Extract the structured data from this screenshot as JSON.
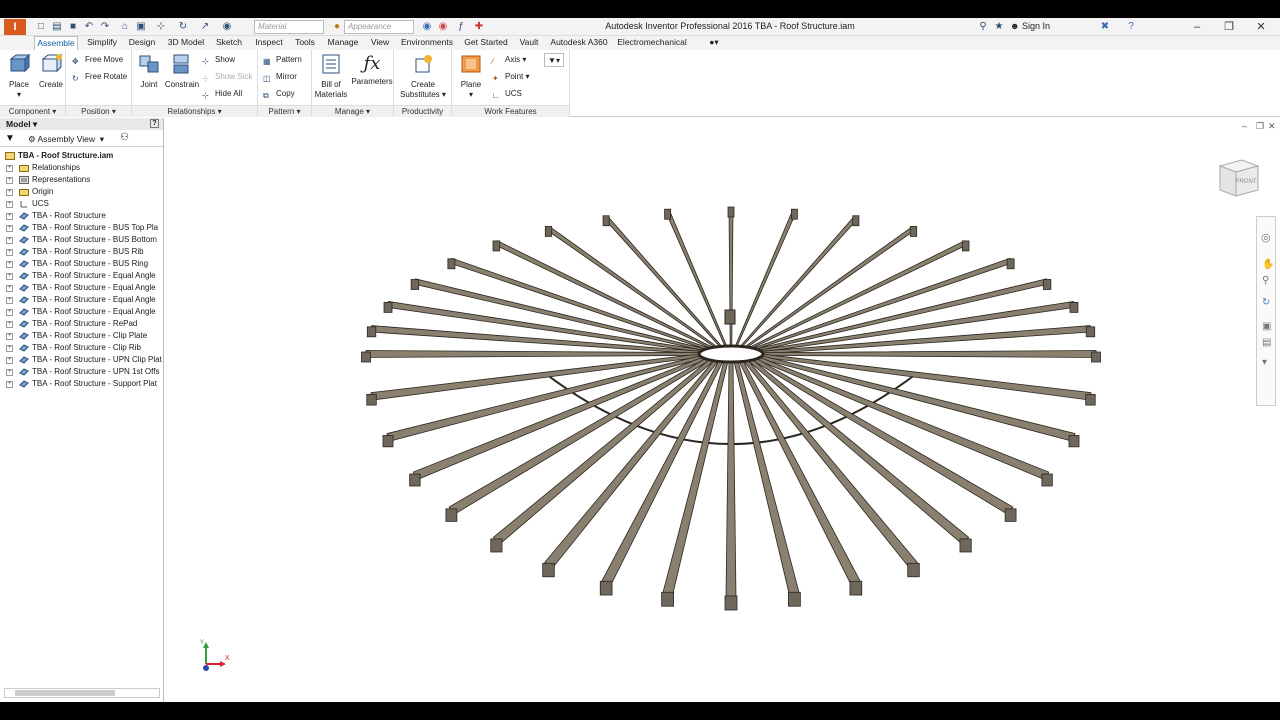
{
  "window": {
    "logo": "I",
    "title": "Autodesk Inventor Professional 2016    TBA - Roof Structure.iam",
    "sign_in": "Sign In",
    "material_placeholder": "Material",
    "appearance_placeholder": "Appearance"
  },
  "tabs": [
    "Assemble",
    "Simplify",
    "Design",
    "3D Model",
    "Sketch",
    "Inspect",
    "Tools",
    "Manage",
    "View",
    "Environments",
    "Get Started",
    "Vault",
    "Autodesk A360",
    "Electromechanical"
  ],
  "ribbon": {
    "component": {
      "label": "Component",
      "place": "Place",
      "create": "Create"
    },
    "position": {
      "label": "Position",
      "free_move": "Free Move",
      "free_rotate": "Free Rotate"
    },
    "relationships": {
      "label": "Relationships",
      "joint": "Joint",
      "constrain": "Constrain",
      "show": "Show",
      "show_sick": "Show Sick",
      "hide_all": "Hide All"
    },
    "pattern": {
      "label": "Pattern",
      "pattern": "Pattern",
      "mirror": "Mirror",
      "copy": "Copy"
    },
    "manage": {
      "label": "Manage",
      "bom_line1": "Bill of",
      "bom_line2": "Materials",
      "parameters": "Parameters"
    },
    "productivity": {
      "label": "Productivity",
      "create_sub_line1": "Create",
      "create_sub_line2": "Substitutes"
    },
    "work_features": {
      "label": "Work Features",
      "plane": "Plane",
      "axis": "Axis",
      "point": "Point",
      "ucs": "UCS"
    }
  },
  "browser": {
    "title": "Model",
    "view_mode": "Assembly View",
    "root": "TBA - Roof Structure.iam",
    "items": [
      {
        "label": "Relationships",
        "icon": "folder-icon"
      },
      {
        "label": "Representations",
        "icon": "representations-icon"
      },
      {
        "label": "Origin",
        "icon": "folder-icon"
      },
      {
        "label": "UCS",
        "icon": "ucs-icon"
      },
      {
        "label": "TBA - Roof Structure",
        "icon": "part-icon"
      },
      {
        "label": "TBA - Roof Structure - BUS Top Pla",
        "icon": "part-icon"
      },
      {
        "label": "TBA - Roof Structure - BUS Bottom",
        "icon": "part-icon"
      },
      {
        "label": "TBA - Roof Structure - BUS Rib",
        "icon": "part-icon"
      },
      {
        "label": "TBA - Roof Structure - BUS Ring",
        "icon": "part-icon"
      },
      {
        "label": "TBA - Roof Structure - Equal Angle",
        "icon": "part-icon"
      },
      {
        "label": "TBA - Roof Structure - Equal Angle",
        "icon": "part-icon"
      },
      {
        "label": "TBA - Roof Structure - Equal Angle",
        "icon": "part-icon"
      },
      {
        "label": "TBA - Roof Structure - Equal Angle",
        "icon": "part-icon"
      },
      {
        "label": "TBA - Roof Structure - RePad",
        "icon": "part-icon"
      },
      {
        "label": "TBA - Roof Structure - Clip Plate",
        "icon": "part-icon"
      },
      {
        "label": "TBA - Roof Structure - Clip Rib",
        "icon": "part-icon"
      },
      {
        "label": "TBA - Roof Structure - UPN Clip Plat",
        "icon": "part-icon"
      },
      {
        "label": "TBA - Roof Structure - UPN 1st Offs",
        "icon": "part-icon"
      },
      {
        "label": "TBA - Roof Structure - Support Plat",
        "icon": "part-icon"
      }
    ]
  },
  "viewport": {
    "viewcube_label": "FRONT",
    "triad_x": "X",
    "triad_y": "Y"
  },
  "colors": {
    "accent": "#0b5ea8",
    "beam": "#8a8070",
    "beam_edge": "#2b2620"
  }
}
